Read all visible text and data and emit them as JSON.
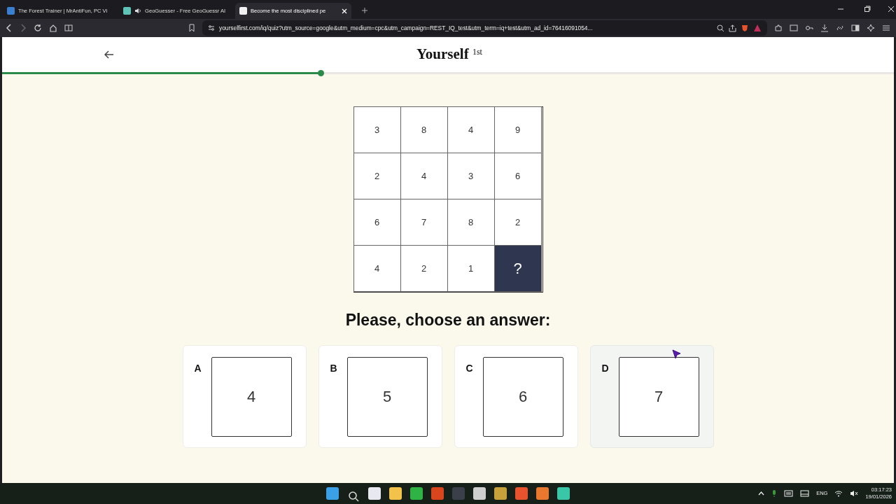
{
  "browser": {
    "tabs": [
      {
        "title": "The Forest Trainer | MrAntiFun, PC Vi",
        "selected": false,
        "audio": false
      },
      {
        "title": "GeoGuesser - Free GeoGuessr AI",
        "selected": false,
        "audio": true
      },
      {
        "title": "Become the most disciplined pe",
        "selected": true,
        "audio": false
      }
    ],
    "url": "yourselfirst.com/iq/quiz?utm_source=google&utm_medium=cpc&utm_campaign=REST_IQ_test&utm_term=iq+test&utm_ad_id=76416091054..."
  },
  "header": {
    "logo": "Yourself",
    "logo_sup": "1st"
  },
  "progress": {
    "level": 0.358
  },
  "puzzle": {
    "rows": [
      [
        "3",
        "8",
        "4",
        "9"
      ],
      [
        "2",
        "4",
        "3",
        "6"
      ],
      [
        "6",
        "7",
        "8",
        "2"
      ],
      [
        "4",
        "2",
        "1",
        "?"
      ]
    ]
  },
  "prompt": "Please, choose an answer:",
  "answers": [
    {
      "letter": "A",
      "value": "4",
      "hovered": false
    },
    {
      "letter": "B",
      "value": "5",
      "hovered": false
    },
    {
      "letter": "C",
      "value": "6",
      "hovered": false
    },
    {
      "letter": "D",
      "value": "7",
      "hovered": true
    }
  ],
  "taskbar": {
    "language": "ENG",
    "time": "03:17:23",
    "date": "19/01/2026"
  }
}
